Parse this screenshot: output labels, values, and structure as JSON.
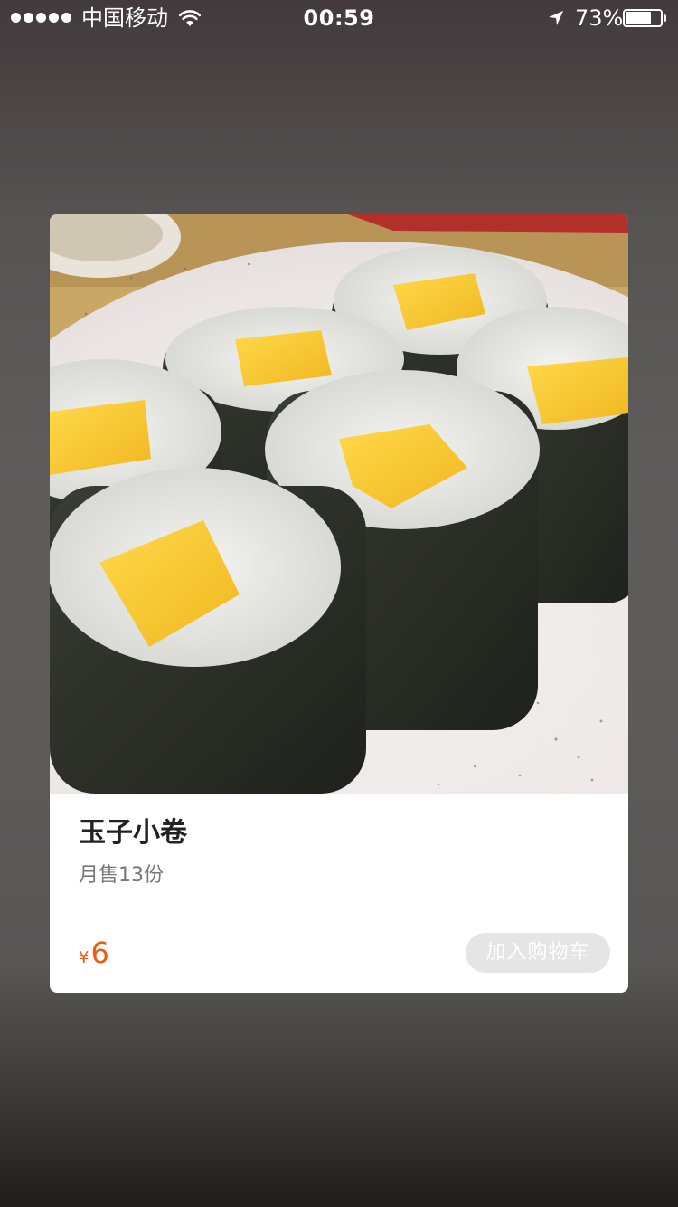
{
  "status_bar": {
    "signal_icon": "signal-dots-icon",
    "carrier": "中国移动",
    "wifi_icon": "wifi-icon",
    "time": "00:59",
    "location_icon": "location-arrow-icon",
    "battery_percent": "73%",
    "battery_level": 0.73,
    "battery_icon": "battery-icon"
  },
  "item": {
    "name": "玉子小卷",
    "monthly_sales": "月售13份",
    "currency_symbol": "¥",
    "price": "6",
    "add_to_cart_label": "加入购物车"
  },
  "colors": {
    "price": "#f05a14",
    "button_disabled_bg": "#e5e5e5",
    "card_bg": "#ffffff"
  }
}
